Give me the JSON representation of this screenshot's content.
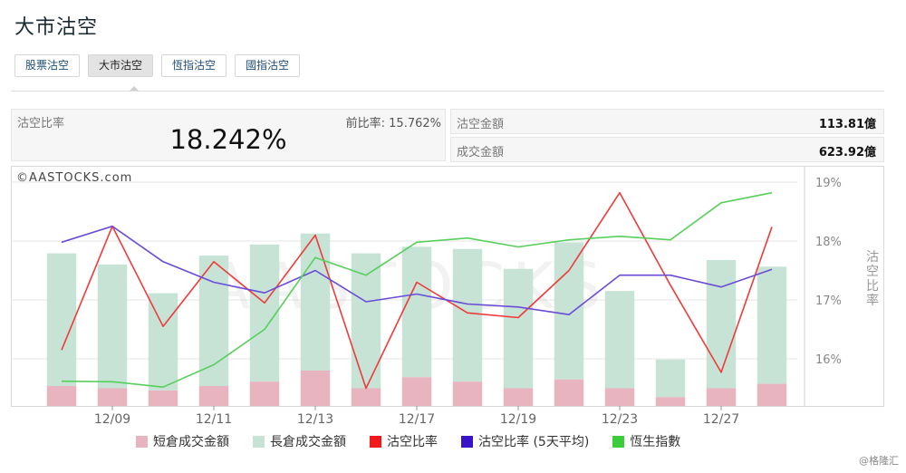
{
  "page_title": "大市沽空",
  "tabs": [
    {
      "label": "股票沽空",
      "active": false
    },
    {
      "label": "大市沽空",
      "active": true
    },
    {
      "label": "恆指沽空",
      "active": false
    },
    {
      "label": "國指沽空",
      "active": false
    }
  ],
  "summary": {
    "ratio_label": "沽空比率",
    "ratio_value": "18.242%",
    "prev_ratio_label": "前比率:",
    "prev_ratio_value": "15.762%",
    "short_amount_label": "沽空金額",
    "short_amount_value": "113.81億",
    "turnover_label": "成交金額",
    "turnover_value": "623.92億"
  },
  "chart_data": {
    "type": "bar",
    "watermark": "©AASTOCKS.com",
    "bg_watermark": "AASTOCKS",
    "x_tick_labels": [
      "12/09",
      "12/11",
      "12/13",
      "12/17",
      "12/19",
      "12/23",
      "12/27"
    ],
    "x_tick_positions": [
      1.5,
      3.5,
      5.5,
      7.5,
      9.5,
      11.5,
      13.5
    ],
    "right_axis_label": "沽空比率",
    "right_axis_ticks": [
      "16%",
      "17%",
      "18%",
      "19%"
    ],
    "ylim_right": [
      15.2,
      19.2
    ],
    "ylim_bar": [
      0,
      100
    ],
    "series": [
      {
        "name": "短倉成交金額",
        "kind": "bar",
        "color": "#e8b4bf",
        "values": [
          9,
          8,
          7,
          9,
          11,
          16,
          8,
          13,
          11,
          8,
          12,
          8,
          4,
          8,
          10
        ]
      },
      {
        "name": "長倉成交金額",
        "kind": "bar",
        "color": "#c7e3d6",
        "values": [
          60,
          56,
          44,
          59,
          62,
          62,
          61,
          59,
          60,
          54,
          62,
          44,
          17,
          58,
          53
        ]
      },
      {
        "name": "沽空比率",
        "kind": "line",
        "color": "#f03a3a",
        "values": [
          16.15,
          18.25,
          16.55,
          17.65,
          16.95,
          18.1,
          15.5,
          17.3,
          16.78,
          16.7,
          17.5,
          18.82,
          17.25,
          15.77,
          18.24
        ]
      },
      {
        "name": "沽空比率 (5天平均)",
        "kind": "line",
        "color": "#6a4bd8",
        "values": [
          17.98,
          18.25,
          17.65,
          17.3,
          17.12,
          17.5,
          16.97,
          17.1,
          16.93,
          16.88,
          16.75,
          17.42,
          17.42,
          17.22,
          17.52
        ]
      },
      {
        "name": "恆生指數",
        "kind": "line",
        "color": "#57d05a",
        "values": [
          15.62,
          15.61,
          15.52,
          15.9,
          16.5,
          17.72,
          17.42,
          17.98,
          18.05,
          17.9,
          18.02,
          18.08,
          18.02,
          18.65,
          18.82
        ]
      }
    ]
  },
  "legend": [
    {
      "label": "短倉成交金額",
      "color": "#e8b4bf"
    },
    {
      "label": "長倉成交金額",
      "color": "#c7e3d6"
    },
    {
      "label": "沽空比率",
      "color": "#f01818"
    },
    {
      "label": "沽空比率 (5天平均)",
      "color": "#3a12c8"
    },
    {
      "label": "恆生指數",
      "color": "#3ccc3c"
    }
  ],
  "footer": "@格隆汇"
}
